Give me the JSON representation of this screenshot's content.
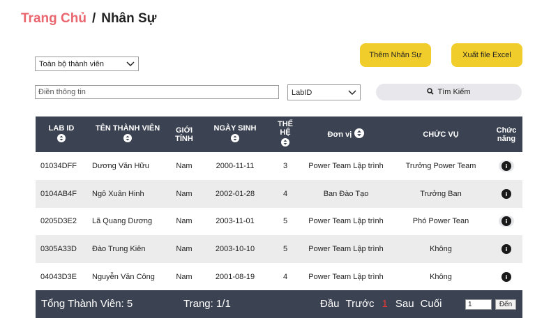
{
  "breadcrumb": {
    "home": "Trang Chủ",
    "separator": "/",
    "current": "Nhân Sự"
  },
  "filters": {
    "member_select": "Toàn bộ thành viên",
    "search_placeholder": "Điền thông tin",
    "field_select": "LabID"
  },
  "buttons": {
    "add_member": "Thêm Nhân Sự",
    "export_excel": "Xuất file Excel",
    "search": "Tìm Kiếm"
  },
  "table": {
    "headers": {
      "lab_id": "LAB ID",
      "name": "TÊN THÀNH VIÊN",
      "gender_1": "GIỚI",
      "gender_2": "TÍNH",
      "dob": "NGÀY SINH",
      "gen_1": "THẾ",
      "gen_2": "HỆ",
      "unit": "Đơn vị",
      "position": "CHỨC VỤ",
      "action_1": "Chức",
      "action_2": "năng"
    },
    "rows": [
      {
        "lab_id": "01034DFF",
        "name": "Dương Văn Hữu",
        "gender": "Nam",
        "dob": "2000-11-11",
        "gen": "3",
        "unit": "Power Team Lập trình",
        "position": "Trưởng Power Team"
      },
      {
        "lab_id": "0104AB4F",
        "name": "Ngô Xuân Hinh",
        "gender": "Nam",
        "dob": "2002-01-28",
        "gen": "4",
        "unit": "Ban Đào Tạo",
        "position": "Trưởng Ban"
      },
      {
        "lab_id": "0205D3E2",
        "name": "Lã Quang Dương",
        "gender": "Nam",
        "dob": "2003-11-01",
        "gen": "5",
        "unit": "Power Team Lập trình",
        "position": "Phó Power Tean"
      },
      {
        "lab_id": "0305A33D",
        "name": "Đào Trung Kiên",
        "gender": "Nam",
        "dob": "2003-10-10",
        "gen": "5",
        "unit": "Power Team Lập trình",
        "position": "Không"
      },
      {
        "lab_id": "04043D3E",
        "name": "Nguyễn Văn Công",
        "gender": "Nam",
        "dob": "2001-08-19",
        "gen": "4",
        "unit": "Power Team Lập trình",
        "position": "Không"
      }
    ]
  },
  "footer": {
    "total": "Tổng Thành Viên: 5",
    "page": "Trang: 1/1",
    "first": "Đầu",
    "prev": "Trước",
    "current": "1",
    "next": "Sau",
    "last": "Cuối",
    "page_input": "1",
    "go": "Đến"
  },
  "colors": {
    "accent": "#f0cd2a",
    "header_bg": "#3b4252",
    "brand_red": "#e9666e"
  }
}
